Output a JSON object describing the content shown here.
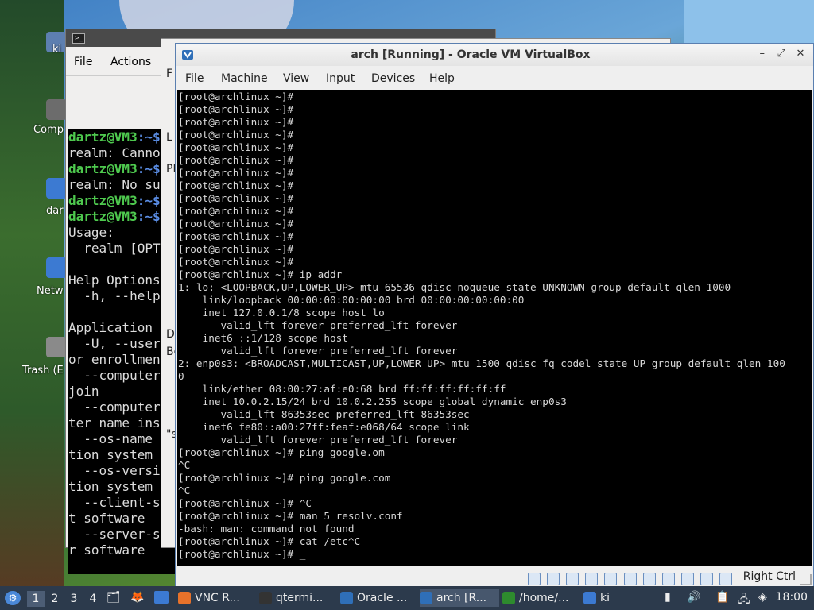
{
  "desktop": {
    "labels": [
      "ki",
      "Comp",
      "dar",
      "Netw",
      "Trash (E"
    ]
  },
  "bg_window": {
    "menu": [
      "File",
      "Actions"
    ],
    "terminal_lines": [
      {
        "prompt": "dartz@VM3",
        "rest": ":~$"
      },
      {
        "text": "realm: Canno"
      },
      {
        "prompt": "dartz@VM3",
        "rest": ":~$"
      },
      {
        "text": "realm: No su"
      },
      {
        "prompt": "dartz@VM3",
        "rest": ":~$"
      },
      {
        "prompt": "dartz@VM3",
        "rest": ":~$"
      },
      {
        "text": "Usage:"
      },
      {
        "text": "  realm [OPT"
      },
      {
        "text": ""
      },
      {
        "text": "Help Options"
      },
      {
        "text": "  -h, --help"
      },
      {
        "text": ""
      },
      {
        "text": "Application"
      },
      {
        "text": "  -U, --user"
      },
      {
        "text": "or enrollmen"
      },
      {
        "text": "  --computer"
      },
      {
        "text": "join"
      },
      {
        "text": "  --computer"
      },
      {
        "text": "ter name ins"
      },
      {
        "text": "  --os-name"
      },
      {
        "text": "tion system"
      },
      {
        "text": "  --os-versio"
      },
      {
        "text": "tion system ve"
      },
      {
        "text": "  --client-sof"
      },
      {
        "text": "t software"
      },
      {
        "text": "  --server-sof"
      },
      {
        "text": "r software"
      }
    ]
  },
  "mid_window": {
    "fragments": [
      "F",
      "L",
      "Pl",
      "De",
      "Bo",
      "\"s"
    ]
  },
  "vbox": {
    "title": "arch [Running] - Oracle VM VirtualBox",
    "controls": [
      "–",
      "⤢",
      "✕"
    ],
    "menu": [
      "File",
      "Machine",
      "View",
      "Input",
      "Devices",
      "Help"
    ],
    "host_key": "Right Ctrl",
    "console": "[root@archlinux ~]#\n[root@archlinux ~]#\n[root@archlinux ~]#\n[root@archlinux ~]#\n[root@archlinux ~]#\n[root@archlinux ~]#\n[root@archlinux ~]#\n[root@archlinux ~]#\n[root@archlinux ~]#\n[root@archlinux ~]#\n[root@archlinux ~]#\n[root@archlinux ~]#\n[root@archlinux ~]#\n[root@archlinux ~]#\n[root@archlinux ~]# ip addr\n1: lo: <LOOPBACK,UP,LOWER_UP> mtu 65536 qdisc noqueue state UNKNOWN group default qlen 1000\n    link/loopback 00:00:00:00:00:00 brd 00:00:00:00:00:00\n    inet 127.0.0.1/8 scope host lo\n       valid_lft forever preferred_lft forever\n    inet6 ::1/128 scope host\n       valid_lft forever preferred_lft forever\n2: enp0s3: <BROADCAST,MULTICAST,UP,LOWER_UP> mtu 1500 qdisc fq_codel state UP group default qlen 100\n0\n    link/ether 08:00:27:af:e0:68 brd ff:ff:ff:ff:ff:ff\n    inet 10.0.2.15/24 brd 10.0.2.255 scope global dynamic enp0s3\n       valid_lft 86353sec preferred_lft 86353sec\n    inet6 fe80::a00:27ff:feaf:e068/64 scope link\n       valid_lft forever preferred_lft forever\n[root@archlinux ~]# ping google.om\n^C\n[root@archlinux ~]# ping google.com\n^C\n[root@archlinux ~]# ^C\n[root@archlinux ~]# man 5 resolv.conf\n-bash: man: command not found\n[root@archlinux ~]# cat /etc^C\n[root@archlinux ~]# _"
  },
  "taskbar": {
    "workspaces": [
      "1",
      "2",
      "3",
      "4"
    ],
    "active_workspace": "1",
    "tasks": [
      {
        "label": "VNC R...",
        "icon": "firefox-icon",
        "color": "#e8722a"
      },
      {
        "label": "qtermi...",
        "icon": "terminal-icon",
        "color": "#333333"
      },
      {
        "label": "Oracle ...",
        "icon": "virtualbox-icon",
        "color": "#2f6fb8"
      },
      {
        "label": "arch [R...",
        "icon": "virtualbox-icon",
        "color": "#2f6fb8"
      },
      {
        "label": "/home/...",
        "icon": "terminal-green-icon",
        "color": "#2e8b2e"
      },
      {
        "label": "ki",
        "icon": "folder-icon",
        "color": "#3c7ad2"
      }
    ],
    "clock": "18:00"
  },
  "colors": {
    "prompt_green": "#4ec94e",
    "path_blue": "#5b8ee6",
    "taskbar_bg": "#2c3a4c"
  }
}
